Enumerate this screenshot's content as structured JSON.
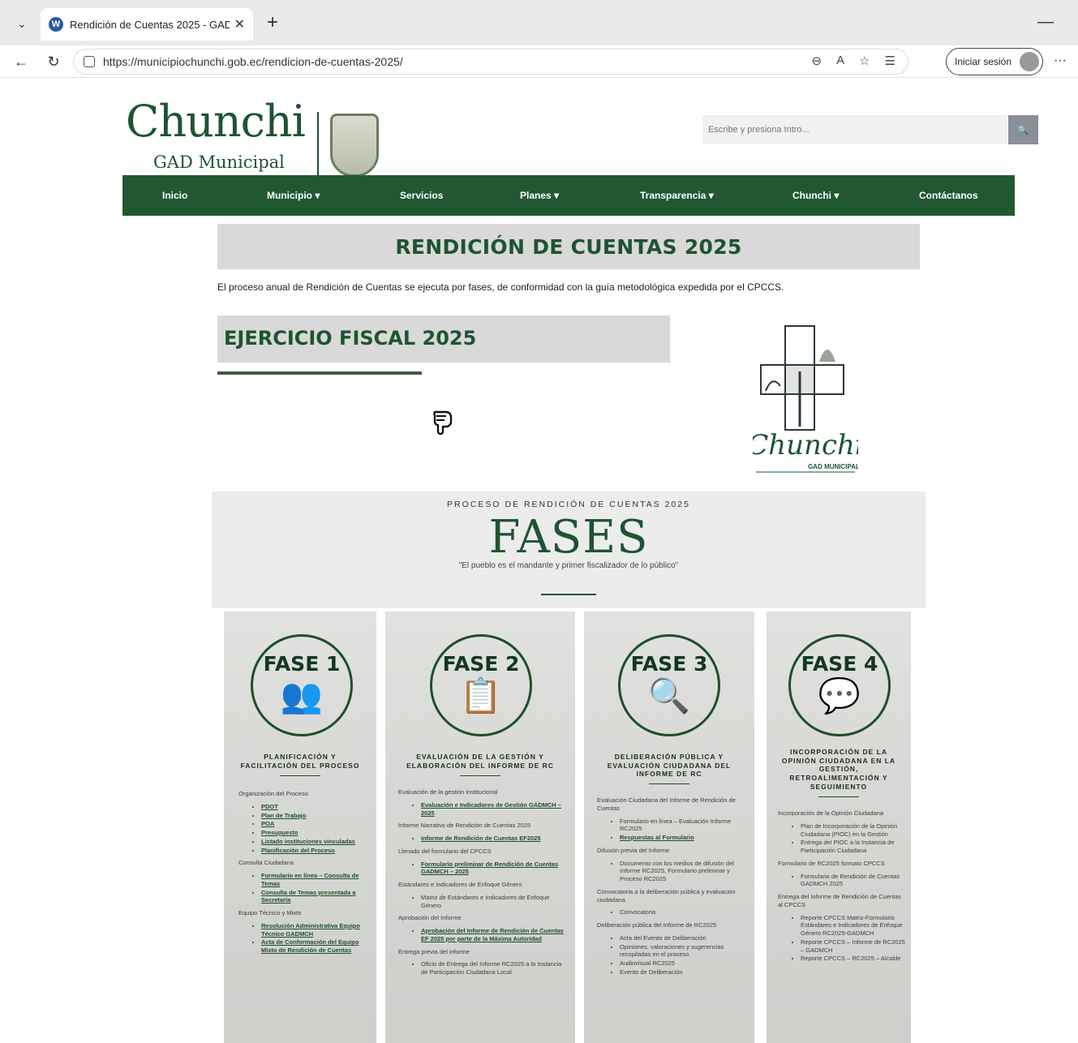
{
  "browser": {
    "tab_title": "Rendición de Cuentas 2025 - GAD",
    "url": "https://municipiochunchi.gob.ec/rendicion-de-cuentas-2025/",
    "signin_label": "Iniciar sesión"
  },
  "site": {
    "logo_text": "Chunchi",
    "logo_sub": "GAD Municipal",
    "search_placeholder": "Escribe y presiona Intro...",
    "nav": [
      "Inicio",
      "Municipio ▾",
      "Servicios",
      "Planes ▾",
      "Transparencia ▾",
      "Chunchi ▾",
      "Contáctanos"
    ],
    "accent_color": "#215832"
  },
  "main": {
    "title": "RENDICIÓN DE CUENTAS 2025",
    "intro": "El proceso anual de Rendición de Cuentas se ejecuta por fases, de conformidad con la guía metodológica expedida por el CPCCS.",
    "fiscal_title": "EJERCICIO FISCAL 2025",
    "brand_script": "Chunchi",
    "brand_caption": "GAD MUNICIPAL"
  },
  "fases": {
    "kicker": "PROCESO DE RENDICIÓN DE CUENTAS 2025",
    "title": "FASES",
    "quote": "\"El pueblo es el mandante y primer fiscalizador de lo público\""
  },
  "phases": [
    {
      "title": "FASE 1",
      "heading": "PLANIFICACIÓN Y FACILITACIÓN DEL PROCESO",
      "sections": [
        {
          "label": "Organización del Proceso",
          "items": [
            "PDOT",
            "Plan de Trabajo",
            "POA",
            "Presupuesto",
            "Listado instituciones vinculadas",
            "Planificación del Proceso"
          ]
        },
        {
          "label": "Consulta Ciudadana",
          "items": [
            "Formulario en línea – Consulta de Temas",
            "Consulta de Temas presentada a Secretaría"
          ]
        },
        {
          "label": "Equipo Técnico y Mixto",
          "items": [
            "Resolución Administrativa Equipo Técnico GADMCH",
            "Acta de Conformación del Equipo Mixto de Rendición de Cuentas"
          ]
        }
      ]
    },
    {
      "title": "FASE 2",
      "heading": "EVALUACIÓN DE LA GESTIÓN Y ELABORACIÓN DEL INFORME DE RC",
      "sections": [
        {
          "label": "Evaluación de la gestión institucional",
          "items": [
            "Evaluación e Indicadores de Gestión GADMCH – 2025"
          ]
        },
        {
          "label": "Informe Narrativo de Rendición de Cuentas 2025",
          "items": [
            "Informe de Rendición de Cuentas EF2025"
          ]
        },
        {
          "label": "Llenado del formulario del CPCCS",
          "items": [
            "Formulario preliminar de Rendición de Cuentas GADMCH – 2025"
          ]
        },
        {
          "label": "Estándares e Indicadores de Enfoque Género",
          "items": [
            "Matriz de Estándares e Indicadores de Enfoque Género"
          ]
        },
        {
          "label": "Aprobación del Informe",
          "items": [
            "Aprobación del Informe de Rendición de Cuentas EF 2025 por parte de la Máxima Autoridad"
          ]
        },
        {
          "label": "Entrega previa del informe",
          "items": [
            "Oficio de Entrega del Informe RC2025 a la Instancia de Participación Ciudadana Local"
          ]
        }
      ]
    },
    {
      "title": "FASE 3",
      "heading": "DELIBERACIÓN PÚBLICA Y EVALUACIÓN CIUDADANA DEL INFORME DE RC",
      "sections": [
        {
          "label": "Evaluación Ciudadana del Informe de Rendición de Cuentas",
          "items": [
            "Formulario en línea – Evaluación Informe RC2025",
            "Respuestas al Formulario"
          ]
        },
        {
          "label": "Difusión previa del Informe",
          "items": [
            "Documento con los medios de difusión del Informe RC2025, Formulario preliminar y Proceso RC2025"
          ]
        },
        {
          "label": "Convocatoria a la deliberación pública y evaluación ciudadana",
          "items": [
            "Convocatoria"
          ]
        },
        {
          "label": "Deliberación pública del Informe de RC2025",
          "items": [
            "Acta del Evento de Deliberación",
            "Opiniones, valoraciones y sugerencias recopiladas en el proceso",
            "Audiovisual RC2025",
            "Evento de Deliberación"
          ]
        }
      ]
    },
    {
      "title": "FASE 4",
      "heading": "INCORPORACIÓN DE LA OPINIÓN CIUDADANA EN LA GESTIÓN, RETROALIMENTACIÓN Y SEGUIMIENTO",
      "sections": [
        {
          "label": "Incorporación de la Opinión Ciudadana",
          "items": [
            "Plan de Incorporación de la Opinión Ciudadana (PIOC) en la Gestión",
            "Entrega del PIOC a la Instancia de Participación Ciudadana"
          ]
        },
        {
          "label": "Formulario de RC2025 formato CPCCS",
          "items": [
            "Formulario de Rendición de Cuentas GADMCH 2025"
          ]
        },
        {
          "label": "Entrega del Informe de Rendición de Cuentas al CPCCS",
          "items": [
            "Reporte CPCCS Matriz-Formulario Estándares e Indicadores de Enfoque Género RC2025-GADMCH",
            "Reporte CPCCS – Informe de RC2025 – GADMCH",
            "Reporte CPCCS – RC2025 – Alcalde"
          ]
        }
      ]
    }
  ]
}
